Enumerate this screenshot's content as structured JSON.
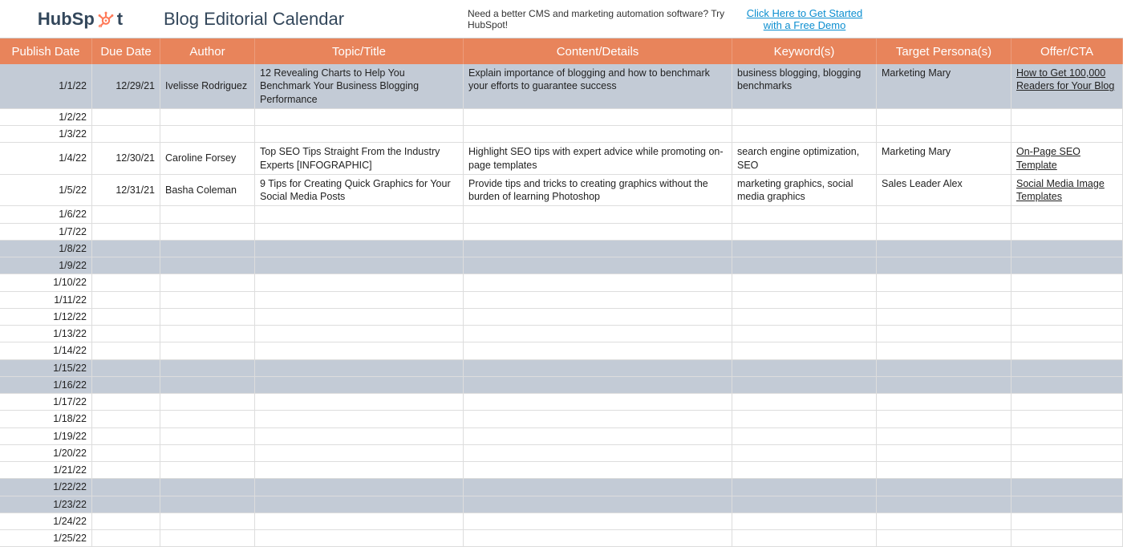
{
  "header": {
    "logo_prefix": "HubSp",
    "logo_suffix": "t",
    "title": "Blog Editorial Calendar",
    "promo_text": "Need a better CMS and marketing automation software? Try HubSpot!",
    "cta_text": "Click Here to Get Started with a Free Demo"
  },
  "columns": {
    "publish": "Publish Date",
    "due": "Due Date",
    "author": "Author",
    "topic": "Topic/Title",
    "content": "Content/Details",
    "keywords": "Keyword(s)",
    "persona": "Target Persona(s)",
    "offer": "Offer/CTA"
  },
  "rows": [
    {
      "publish": "1/1/22",
      "due": "12/29/21",
      "author": "Ivelisse Rodriguez",
      "topic": "12 Revealing Charts to Help You Benchmark Your Business Blogging Performance",
      "content": "Explain importance of blogging and how to benchmark your efforts to guarantee success",
      "keywords": "business blogging, blogging benchmarks",
      "persona": "Marketing Mary",
      "offer": "How to Get 100,000 Readers for Your Blog",
      "offer_is_link": true,
      "highlighted": true
    },
    {
      "publish": "1/2/22",
      "highlighted": false
    },
    {
      "publish": "1/3/22",
      "highlighted": false
    },
    {
      "publish": "1/4/22",
      "due": "12/30/21",
      "author": "Caroline Forsey",
      "topic": "Top SEO Tips Straight From the Industry Experts [INFOGRAPHIC]",
      "content": "Highlight SEO tips with expert advice while promoting on-page templates",
      "keywords": "search engine optimization, SEO",
      "persona": "Marketing Mary",
      "offer": "On-Page SEO Template",
      "offer_is_link": true,
      "highlighted": false
    },
    {
      "publish": "1/5/22",
      "due": "12/31/21",
      "author": "Basha Coleman",
      "topic": "9 Tips for Creating Quick Graphics for Your Social Media Posts",
      "content": "Provide tips and tricks to creating graphics without the burden of learning Photoshop",
      "keywords": "marketing graphics, social media graphics",
      "persona": "Sales Leader Alex",
      "offer": "Social Media Image Templates",
      "offer_is_link": true,
      "highlighted": false
    },
    {
      "publish": "1/6/22",
      "highlighted": false
    },
    {
      "publish": "1/7/22",
      "highlighted": false
    },
    {
      "publish": "1/8/22",
      "highlighted": true
    },
    {
      "publish": "1/9/22",
      "highlighted": true
    },
    {
      "publish": "1/10/22",
      "highlighted": false
    },
    {
      "publish": "1/11/22",
      "highlighted": false
    },
    {
      "publish": "1/12/22",
      "highlighted": false
    },
    {
      "publish": "1/13/22",
      "highlighted": false
    },
    {
      "publish": "1/14/22",
      "highlighted": false
    },
    {
      "publish": "1/15/22",
      "highlighted": true
    },
    {
      "publish": "1/16/22",
      "highlighted": true
    },
    {
      "publish": "1/17/22",
      "highlighted": false
    },
    {
      "publish": "1/18/22",
      "highlighted": false
    },
    {
      "publish": "1/19/22",
      "highlighted": false
    },
    {
      "publish": "1/20/22",
      "highlighted": false
    },
    {
      "publish": "1/21/22",
      "highlighted": false
    },
    {
      "publish": "1/22/22",
      "highlighted": true
    },
    {
      "publish": "1/23/22",
      "highlighted": true
    },
    {
      "publish": "1/24/22",
      "highlighted": false
    },
    {
      "publish": "1/25/22",
      "highlighted": false
    }
  ]
}
